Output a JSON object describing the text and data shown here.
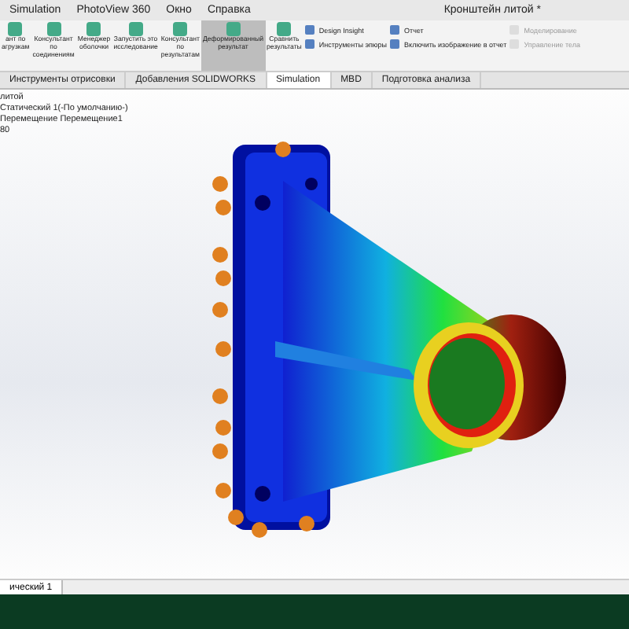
{
  "menu": [
    "Simulation",
    "PhotoView 360",
    "Окно",
    "Справка"
  ],
  "window": {
    "title": "Кронштейн литой *"
  },
  "ribbon": [
    {
      "kind": "big",
      "label": "ант по агрузкам",
      "selected": false
    },
    {
      "kind": "big",
      "label": "Консультант по соединениям",
      "selected": false
    },
    {
      "kind": "big",
      "label": "Менеджер оболочки",
      "selected": false
    },
    {
      "kind": "big",
      "label": "Запустить это исследование",
      "selected": false
    },
    {
      "kind": "big",
      "label": "Консультант по результатам",
      "selected": false
    },
    {
      "kind": "big",
      "label": "Деформированный результат",
      "selected": true
    },
    {
      "kind": "big",
      "label": "Сравнить результаты",
      "selected": false
    },
    {
      "kind": "small",
      "items": [
        {
          "label": "Design Insight",
          "disabled": false
        },
        {
          "label": "Инструменты эпюры",
          "disabled": false
        }
      ]
    },
    {
      "kind": "small",
      "items": [
        {
          "label": "Отчет",
          "disabled": false
        },
        {
          "label": "Включить изображение в отчет",
          "disabled": false
        }
      ]
    },
    {
      "kind": "small",
      "items": [
        {
          "label": "Моделирование",
          "disabled": true
        },
        {
          "label": "Управление тела",
          "disabled": true
        }
      ]
    }
  ],
  "tabs": [
    {
      "label": "Инструменты отрисовки",
      "selected": false
    },
    {
      "label": "Добавления SOLIDWORKS",
      "selected": false
    },
    {
      "label": "Simulation",
      "selected": true
    },
    {
      "label": "MBD",
      "selected": false
    },
    {
      "label": "Подготовка анализа",
      "selected": false
    }
  ],
  "tree": [
    "литой",
    "Статический 1(-По умолчанию-)",
    "Перемещение Перемещение1",
    "80"
  ],
  "bottom_tabs": [
    {
      "label": "ический 1",
      "selected": true
    }
  ]
}
